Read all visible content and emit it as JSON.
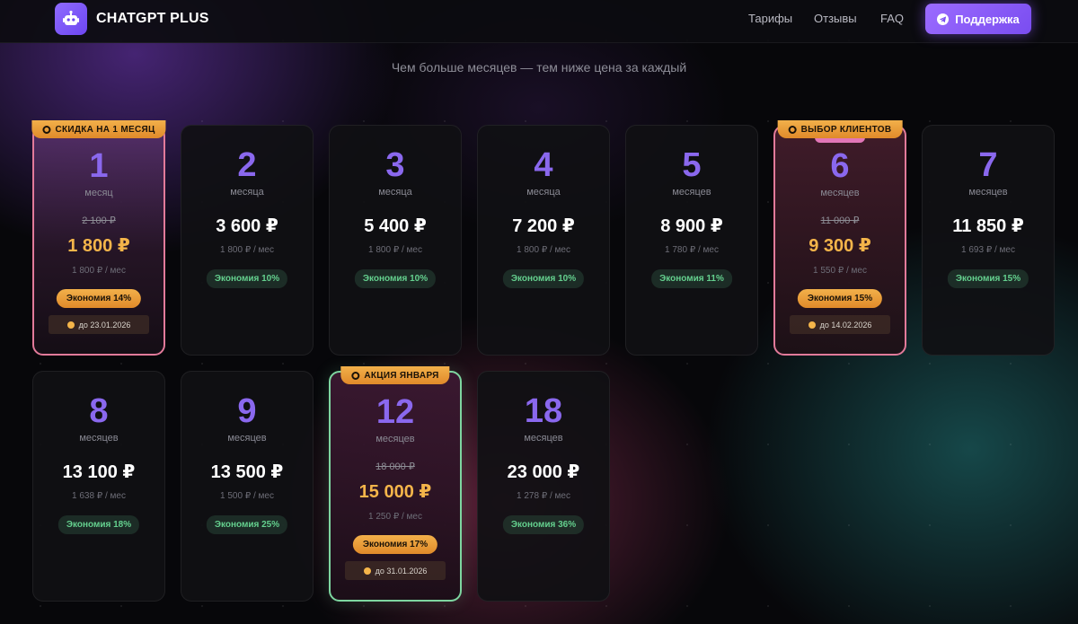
{
  "header": {
    "brand": "CHATGPT PLUS",
    "nav": [
      "Тарифы",
      "Отзывы",
      "FAQ"
    ],
    "support_label": "Поддержка"
  },
  "subtitle": "Чем больше месяцев — тем ниже цена за каждый",
  "colors": {
    "accent": "#8a68ee",
    "gold": "#f4b54a",
    "green": "#64d08e",
    "pink_border": "#e27a9a",
    "green_border": "#7ed6a0"
  },
  "plans": [
    {
      "months": "1",
      "unit": "месяц",
      "ribbon": "СКИДКА НА 1 МЕСЯЦ",
      "old_price": "2 100 ₽",
      "price": "1 800 ₽",
      "per_month": "1 800 ₽ / мес",
      "save": "Экономия 14%",
      "deadline": "до 23.01.2026"
    },
    {
      "months": "2",
      "unit": "месяца",
      "price": "3 600 ₽",
      "per_month": "1 800 ₽ / мес",
      "save": "Экономия 10%"
    },
    {
      "months": "3",
      "unit": "месяца",
      "price": "5 400 ₽",
      "per_month": "1 800 ₽ / мес",
      "save": "Экономия 10%"
    },
    {
      "months": "4",
      "unit": "месяца",
      "price": "7 200 ₽",
      "per_month": "1 800 ₽ / мес",
      "save": "Экономия 10%"
    },
    {
      "months": "5",
      "unit": "месяцев",
      "price": "8 900 ₽",
      "per_month": "1 780 ₽ / мес",
      "save": "Экономия 11%"
    },
    {
      "months": "6",
      "unit": "месяцев",
      "ribbon": "ВЫБОР КЛИЕНТОВ",
      "old_price": "11 000 ₽",
      "price": "9 300 ₽",
      "per_month": "1 550 ₽ / мес",
      "save": "Экономия 15%",
      "deadline": "до 14.02.2026"
    },
    {
      "months": "7",
      "unit": "месяцев",
      "price": "11 850 ₽",
      "per_month": "1 693 ₽ / мес",
      "save": "Экономия 15%"
    },
    {
      "months": "8",
      "unit": "месяцев",
      "price": "13 100 ₽",
      "per_month": "1 638 ₽ / мес",
      "save": "Экономия 18%"
    },
    {
      "months": "9",
      "unit": "месяцев",
      "price": "13 500 ₽",
      "per_month": "1 500 ₽ / мес",
      "save": "Экономия 25%"
    },
    {
      "months": "12",
      "unit": "месяцев",
      "ribbon": "АКЦИЯ ЯНВАРЯ",
      "old_price": "18 000 ₽",
      "price": "15 000 ₽",
      "per_month": "1 250 ₽ / мес",
      "save": "Экономия 17%",
      "deadline": "до 31.01.2026"
    },
    {
      "months": "18",
      "unit": "месяцев",
      "price": "23 000 ₽",
      "per_month": "1 278 ₽ / мес",
      "save": "Экономия 36%"
    }
  ]
}
